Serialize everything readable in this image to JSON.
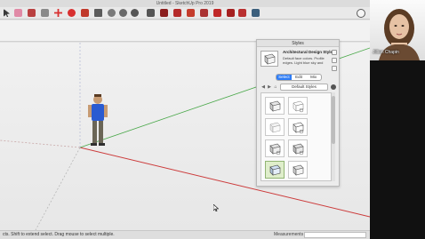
{
  "window": {
    "title": "Untitled - SketchUp Pro 2019"
  },
  "toolbar": {
    "icons": [
      "select-icon",
      "eraser-icon",
      "paint-bucket-icon",
      "move-icon",
      "rotate-icon",
      "scale-icon",
      "offset-icon",
      "tape-measure-icon",
      "text-icon",
      "orbit-icon",
      "pan-icon",
      "zoom-icon",
      "zoom-extents-icon",
      "3d-warehouse-icon",
      "extension-warehouse-icon",
      "layout-icon",
      "extension-manager-icon",
      "ruby-console-icon",
      "profile-icon"
    ]
  },
  "styles_panel": {
    "title": "Styles",
    "style_name": "Architectural Design Style",
    "style_description": "Default face colors. Profile edges. Light blue sky and",
    "tabs": [
      {
        "label": "Select",
        "active": true
      },
      {
        "label": "Edit",
        "active": false
      },
      {
        "label": "Mix",
        "active": false
      }
    ],
    "collection": "Default Styles",
    "thumbnails_count": 8
  },
  "statusbar": {
    "text": "cts. Shift to extend select. Drag mouse to select multiple.",
    "measurements_label": "Measurements",
    "measurements_value": ""
  },
  "video": {
    "participant_name": "Jillian Chapin"
  },
  "colors": {
    "accent": "#2d7cf6",
    "red_axis": "#cc3b3b",
    "green_axis": "#4aa84a",
    "blue_axis": "#3b5bcc"
  }
}
